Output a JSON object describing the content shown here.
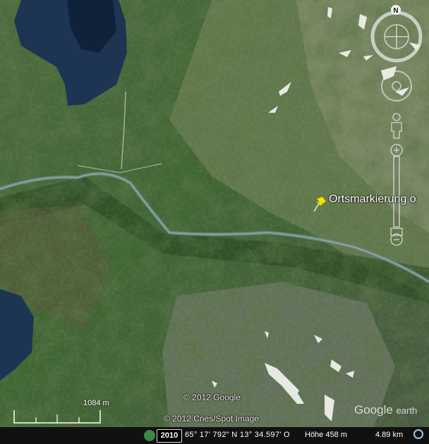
{
  "placemark": {
    "label": "Ortsmarkierung o",
    "icon": "pushpin-icon",
    "color": "#f2e600"
  },
  "navigation": {
    "compass_letter": "N",
    "icons": [
      "compass-ring-icon",
      "look-joystick-icon",
      "move-joystick-icon",
      "pegman-icon",
      "zoom-slider-icon"
    ]
  },
  "imagery": {
    "copyright_1": "© 2012 Google",
    "copyright_2": "© 2012 Cnes/Spot Image",
    "logo_google": "Google",
    "logo_earth": "earth"
  },
  "scale": {
    "label": "1084  m"
  },
  "status": {
    "year": "2010",
    "coordinates": "65° 17' 792\" N  13° 34.597' O",
    "elevation": "Höhe  458 m",
    "eye_altitude": "4.89 km"
  }
}
